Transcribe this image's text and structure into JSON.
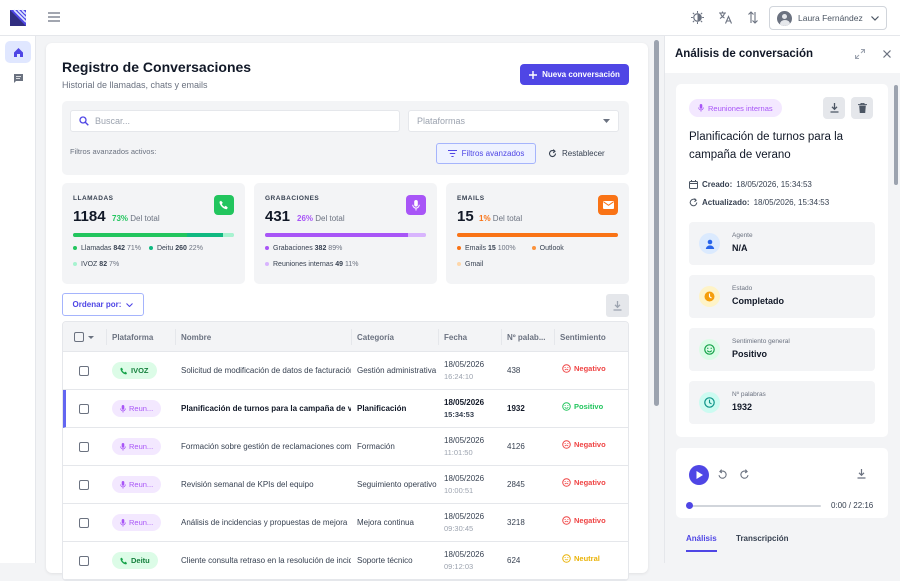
{
  "header": {
    "user_name": "Laura Fernández"
  },
  "sidebar": {
    "items": [
      {
        "icon": "home-icon"
      },
      {
        "icon": "chat-icon"
      }
    ]
  },
  "main": {
    "title": "Registro de Conversaciones",
    "subtitle": "Historial de llamadas, chats y emails",
    "new_button": "Nueva conversación",
    "search_placeholder": "Buscar...",
    "platform_placeholder": "Plataformas",
    "filters_active": "Filtros avanzados activos:",
    "advanced_button": "Filtros avanzados",
    "reset_button": "Restablecer",
    "order_button": "Ordenar por:",
    "stats": {
      "calls": {
        "label": "LLAMADAS",
        "value": "1184",
        "pct": "73%",
        "pct_suffix": "Del total",
        "color": "#22c55e",
        "legend": [
          {
            "name": "Llamadas",
            "count": "842",
            "pct": "71%",
            "color": "#22c55e",
            "fill": 0.71
          },
          {
            "name": "Deitu",
            "count": "260",
            "pct": "22%",
            "color": "#10b981",
            "fill": 0.22
          },
          {
            "name": "IVOZ",
            "count": "82",
            "pct": "7%",
            "color": "#a7f3d0",
            "fill": 0.07
          }
        ]
      },
      "recordings": {
        "label": "GRABACIONES",
        "value": "431",
        "pct": "26%",
        "pct_suffix": "Del total",
        "color": "#a855f7",
        "legend": [
          {
            "name": "Grabaciones",
            "count": "382",
            "pct": "89%",
            "color": "#a855f7",
            "fill": 0.89
          },
          {
            "name": "Reuniones internas",
            "count": "49",
            "pct": "11%",
            "color": "#d8b4fe",
            "fill": 0.11
          }
        ]
      },
      "emails": {
        "label": "EMAILS",
        "value": "15",
        "pct": "1%",
        "pct_suffix": "Del total",
        "color": "#f97316",
        "legend": [
          {
            "name": "Emails",
            "count": "15",
            "pct": "100%",
            "color": "#f97316",
            "fill": 1
          },
          {
            "name": "Outlook",
            "count": "",
            "pct": "",
            "color": "#fb923c",
            "fill": 0
          },
          {
            "name": "Gmail",
            "count": "",
            "pct": "",
            "color": "#fed7aa",
            "fill": 0
          }
        ]
      }
    },
    "table": {
      "headers": [
        "Plataforma",
        "Nombre",
        "Categoría",
        "Fecha",
        "Nº palab...",
        "Sentimiento"
      ],
      "rows": [
        {
          "platform": "IVOZ",
          "name": "Solicitud de modificación de datos de facturación",
          "category": "Gestión administrativa",
          "date": "18/05/2026",
          "time": "16:24:10",
          "words": "438",
          "sentiment": "Negativo"
        },
        {
          "platform": "Reun...",
          "name": "Planificación de turnos para la campaña de verano",
          "category": "Planificación",
          "date": "18/05/2026",
          "time": "15:34:53",
          "words": "1932",
          "sentiment": "Positivo"
        },
        {
          "platform": "Reun...",
          "name": "Formación sobre gestión de reclamaciones complejas",
          "category": "Formación",
          "date": "18/05/2026",
          "time": "11:01:50",
          "words": "4126",
          "sentiment": "Negativo"
        },
        {
          "platform": "Reun...",
          "name": "Revisión semanal de KPIs del equipo",
          "category": "Seguimiento operativo",
          "date": "18/05/2026",
          "time": "10:00:51",
          "words": "2845",
          "sentiment": "Negativo"
        },
        {
          "platform": "Reun...",
          "name": "Análisis de incidencias y propuestas de mejora",
          "category": "Mejora continua",
          "date": "18/05/2026",
          "time": "09:30:45",
          "words": "3218",
          "sentiment": "Negativo"
        },
        {
          "platform": "Deitu",
          "name": "Cliente consulta retraso en la resolución de incidencia",
          "category": "Soporte técnico",
          "date": "18/05/2026",
          "time": "09:12:03",
          "words": "624",
          "sentiment": "Neutral"
        }
      ]
    }
  },
  "panel": {
    "title": "Análisis de conversación",
    "tag": "Reuniones internas",
    "conv_title": "Planificación de turnos para la campaña de verano",
    "created_label": "Creado:",
    "created": "18/05/2026, 15:34:53",
    "updated_label": "Actualizado:",
    "updated": "18/05/2026, 15:34:53",
    "info": [
      {
        "key": "Agente",
        "value": "N/A"
      },
      {
        "key": "Estado",
        "value": "Completado"
      },
      {
        "key": "Sentimiento general",
        "value": "Positivo"
      },
      {
        "key": "Nº palabras",
        "value": "1932"
      }
    ],
    "player_time": "0:00 / 22:16",
    "player_progress": 0,
    "tabs": [
      "Análisis",
      "Transcripción"
    ]
  },
  "colors": {
    "accent": "#4f46e5",
    "positive": "#22c55e",
    "negative": "#ef4444",
    "neutral": "#eab308"
  }
}
